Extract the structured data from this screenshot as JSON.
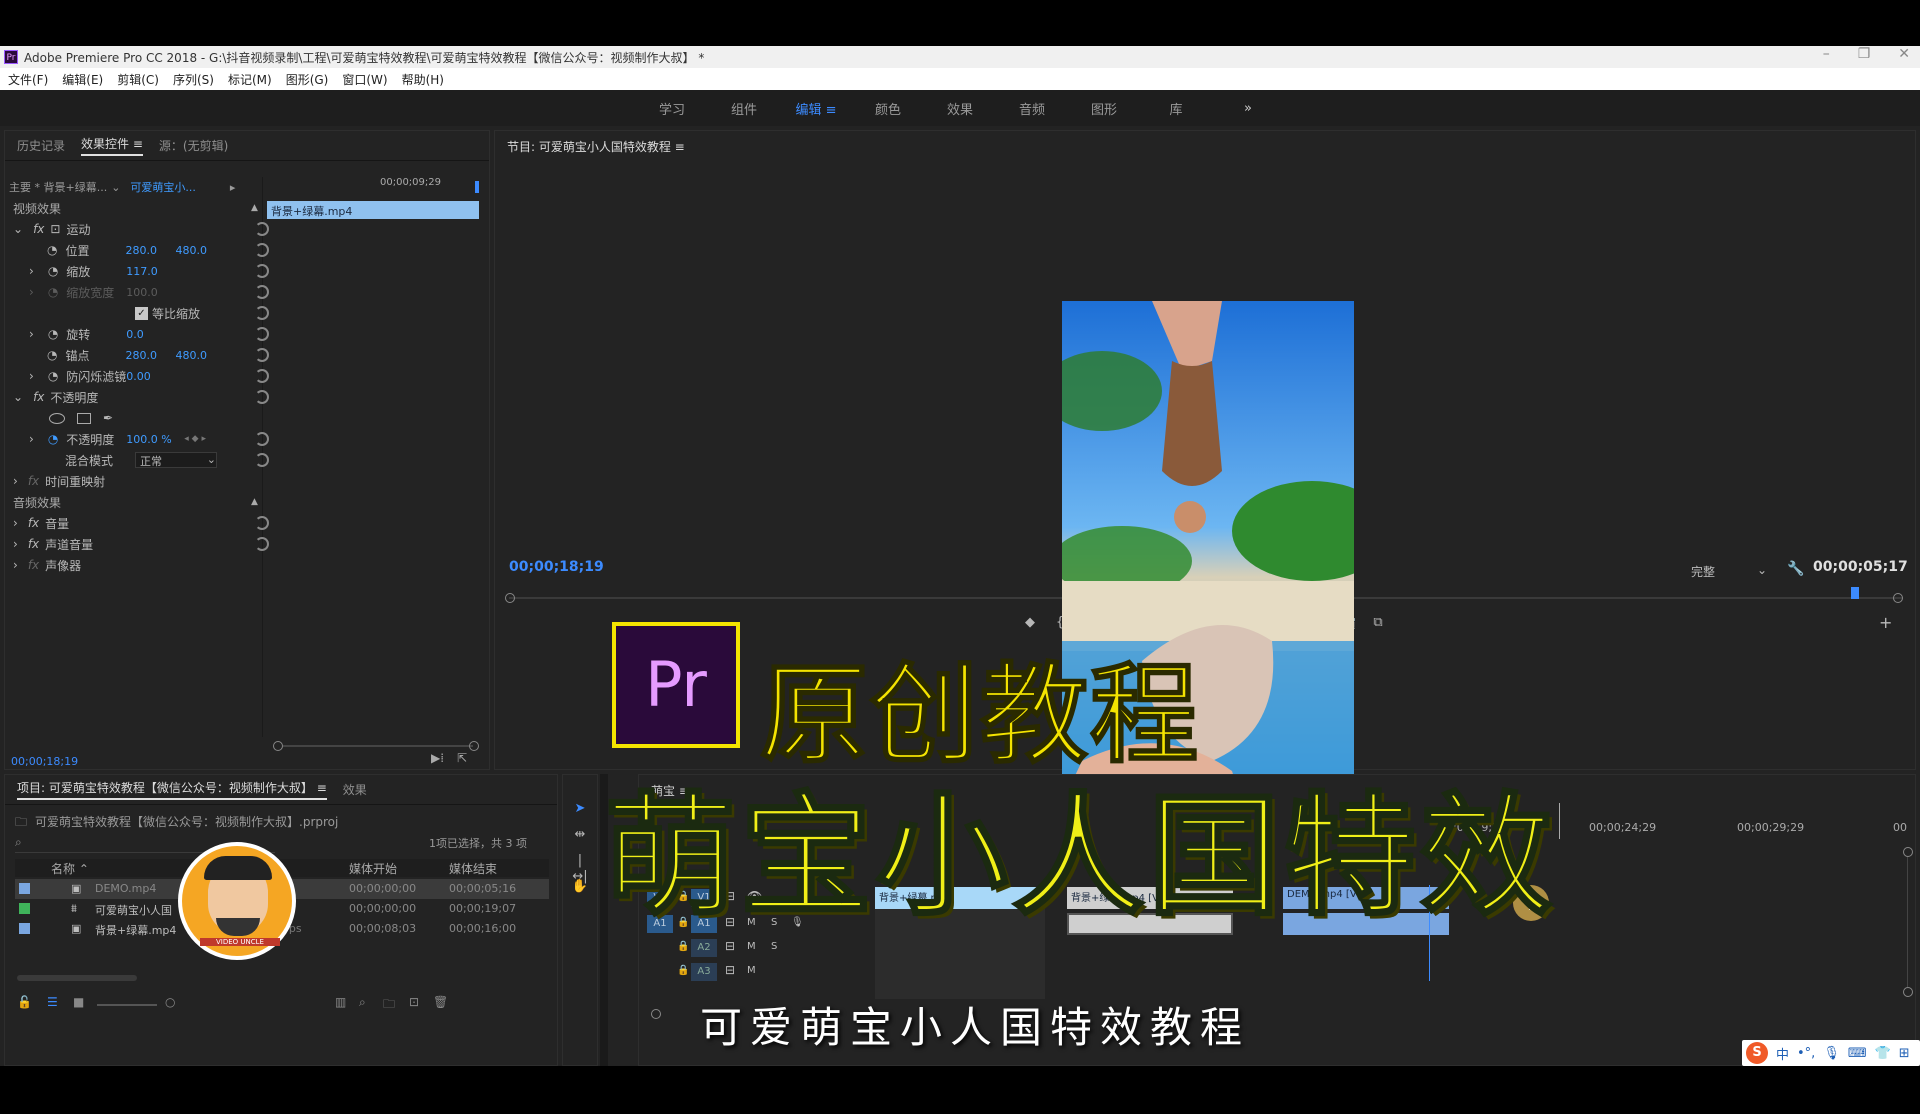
{
  "window": {
    "title": "Adobe Premiere Pro CC 2018 - G:\\抖音视频录制\\工程\\可爱萌宝特效教程\\可爱萌宝特效教程【微信公众号：视频制作大叔】 *",
    "app_icon": "Pr"
  },
  "menu": [
    "文件(F)",
    "编辑(E)",
    "剪辑(C)",
    "序列(S)",
    "标记(M)",
    "图形(G)",
    "窗口(W)",
    "帮助(H)"
  ],
  "workspaces": {
    "items": [
      "学习",
      "组件",
      "编辑",
      "颜色",
      "效果",
      "音频",
      "图形",
      "库"
    ],
    "active": "编辑",
    "more": "»"
  },
  "effect_controls": {
    "tabs": [
      "历史记录",
      "效果控件",
      "源：(无剪辑)"
    ],
    "active_tab": "效果控件",
    "source_label": "主要 * 背景+绿幕...",
    "sequence_label": "可爱萌宝小...",
    "timecode_head": "00;00;09;29",
    "clip_name": "背景+绿幕.mp4",
    "video_effects": "视频效果",
    "motion": "运动",
    "position_label": "位置",
    "position_x": "280.0",
    "position_y": "480.0",
    "scale_label": "缩放",
    "scale": "117.0",
    "scale_width_label": "缩放宽度",
    "scale_width": "100.0",
    "uniform_scale": "等比缩放",
    "rotation_label": "旋转",
    "rotation": "0.0",
    "anchor_label": "锚点",
    "anchor_x": "280.0",
    "anchor_y": "480.0",
    "antiflicker_label": "防闪烁滤镜",
    "antiflicker": "0.00",
    "opacity_group": "不透明度",
    "opacity_label": "不透明度",
    "opacity": "100.0 %",
    "blend_label": "混合模式",
    "blend_value": "正常",
    "time_remap": "时间重映射",
    "audio_effects": "音频效果",
    "volume": "音量",
    "channel_volume": "声道音量",
    "panner": "声像器",
    "footer_timecode": "00;00;18;19"
  },
  "program_monitor": {
    "title": "节目: 可爱萌宝小人国特效教程",
    "timecode_left": "00;00;18;19",
    "timecode_right": "00;00;05;17",
    "quality": "完整"
  },
  "project": {
    "tab": "项目: 可爱萌宝特效教程【微信公众号：视频制作大叔】",
    "effects_tab": "效果",
    "file": "可爱萌宝特效教程【微信公众号：视频制作大叔】.prproj",
    "selection": "1项已选择，共 3 项",
    "columns": [
      "名称",
      "媒体开始",
      "媒体结束"
    ],
    "rows": [
      {
        "name": "DEMO.mp4",
        "start": "00;00;00;00",
        "end": "00;00;05;16",
        "color": "#7aa6e0"
      },
      {
        "name": "可爱萌宝小人国",
        "start": "00;00;00;00",
        "end": "00;00;19;07",
        "color": "#3fb35a"
      },
      {
        "name": "背景+绿幕.mp4",
        "start": "00;00;08;03",
        "end": "00;00;16;00",
        "color": "#7aa6e0"
      }
    ],
    "fps_label": "fps"
  },
  "timeline": {
    "tab": "萌宝",
    "ruler": [
      "00;00;19;29",
      "00;00;24;29",
      "00;00;29;29"
    ],
    "ruler_partial": [
      "4:29",
      "00"
    ],
    "tracks": [
      "V3",
      "V2",
      "V1",
      "A1",
      "A2",
      "A3"
    ],
    "clips": [
      {
        "label": "背景+绿幕.mp4",
        "track": "V1",
        "kind": "video-selected"
      },
      {
        "label": "背景+绿幕.mp4 [V]",
        "track": "V1",
        "kind": "video"
      },
      {
        "label": "DEMO.mp4 [V]",
        "track": "V1",
        "kind": "video-blue"
      }
    ],
    "track_buttons": [
      "M",
      "S"
    ]
  },
  "overlay": {
    "badge": "Pr",
    "title": "原创教程",
    "headline": "萌宝小人国特效",
    "subtitle": "可爱萌宝小人国特效教程",
    "avatar_text": "VIDEO UNCLE"
  },
  "ime": {
    "logo": "S",
    "items": [
      "中",
      "•",
      "°,",
      "mic",
      "kbd",
      "shirt",
      "grid"
    ]
  },
  "colors": {
    "accent_blue": "#3c8bff",
    "title_yellow": "#f4e400",
    "headline_yellow": "#f0ef17",
    "pr_purple": "#2a0a3a",
    "pr_text": "#e59bff"
  }
}
